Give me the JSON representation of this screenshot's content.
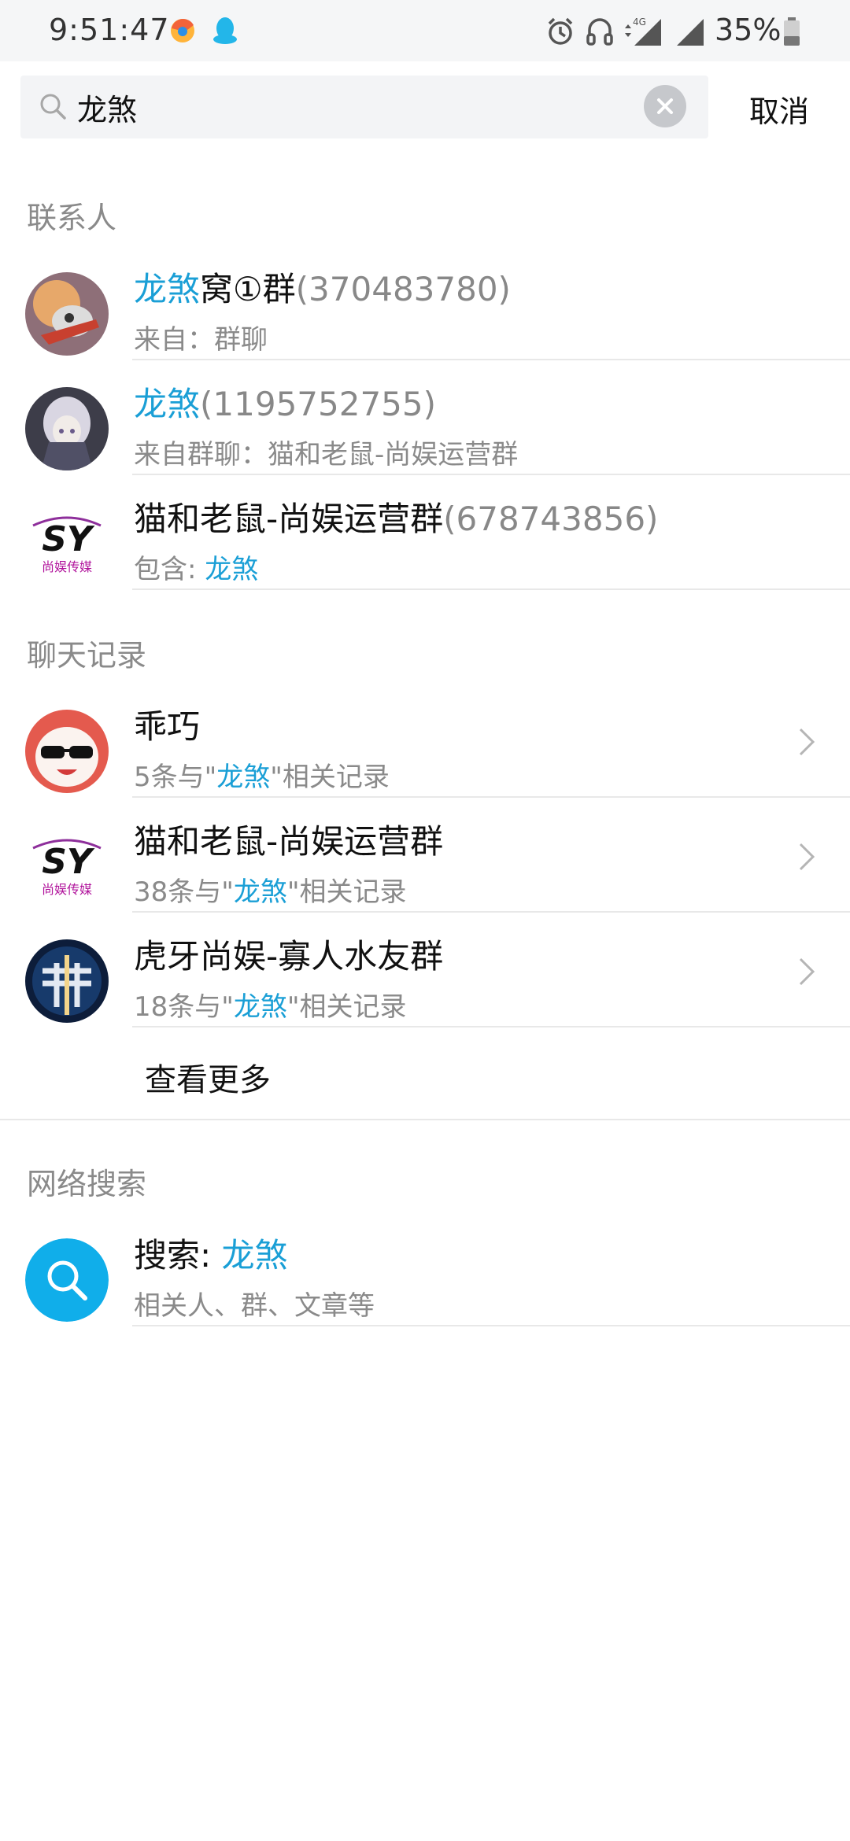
{
  "status_bar": {
    "time": "9:51:47",
    "battery": "35%",
    "icons": [
      "browser-app-icon",
      "qq-penguin-icon",
      "alarm-icon",
      "headset-icon",
      "4g-signal-icon",
      "signal-icon",
      "battery-icon"
    ],
    "network_label": "4G"
  },
  "search": {
    "value": "龙煞",
    "cancel_label": "取消"
  },
  "sections": {
    "contacts_header": "联系人",
    "chat_history_header": "聊天记录",
    "web_search_header": "网络搜索"
  },
  "contacts": [
    {
      "title_highlight": "龙煞",
      "title_rest": "窝①群",
      "number": "(370483780)",
      "subtitle_prefix": "来自：群聊",
      "subtitle_highlight": ""
    },
    {
      "title_highlight": "龙煞",
      "title_rest": "",
      "number": "(1195752755)",
      "subtitle_prefix": "来自群聊：猫和老鼠-尚娱运营群",
      "subtitle_highlight": ""
    },
    {
      "title_highlight": "",
      "title_rest": "猫和老鼠-尚娱运营群",
      "number": "(678743856)",
      "subtitle_prefix": "包含: ",
      "subtitle_highlight": "龙煞"
    }
  ],
  "chat_history": [
    {
      "title": "乖巧",
      "count_prefix": "5条与\"",
      "keyword": "龙煞",
      "count_suffix": "\"相关记录"
    },
    {
      "title": "猫和老鼠-尚娱运营群",
      "count_prefix": "38条与\"",
      "keyword": "龙煞",
      "count_suffix": "\"相关记录"
    },
    {
      "title": "虎牙尚娱-寡人水友群",
      "count_prefix": "18条与\"",
      "keyword": "龙煞",
      "count_suffix": "\"相关记录"
    }
  ],
  "more_label": "查看更多",
  "web_search": {
    "title_prefix": "搜索: ",
    "keyword": "龙煞",
    "subtitle": "相关人、群、文章等"
  },
  "sy_logo_text": "SY",
  "sy_logo_sub": "尚娱传媒",
  "colors": {
    "highlight": "#1a9fd6",
    "muted": "#8a8a8a",
    "search_bg": "#f3f4f6",
    "web_search_icon": "#10aeea"
  }
}
